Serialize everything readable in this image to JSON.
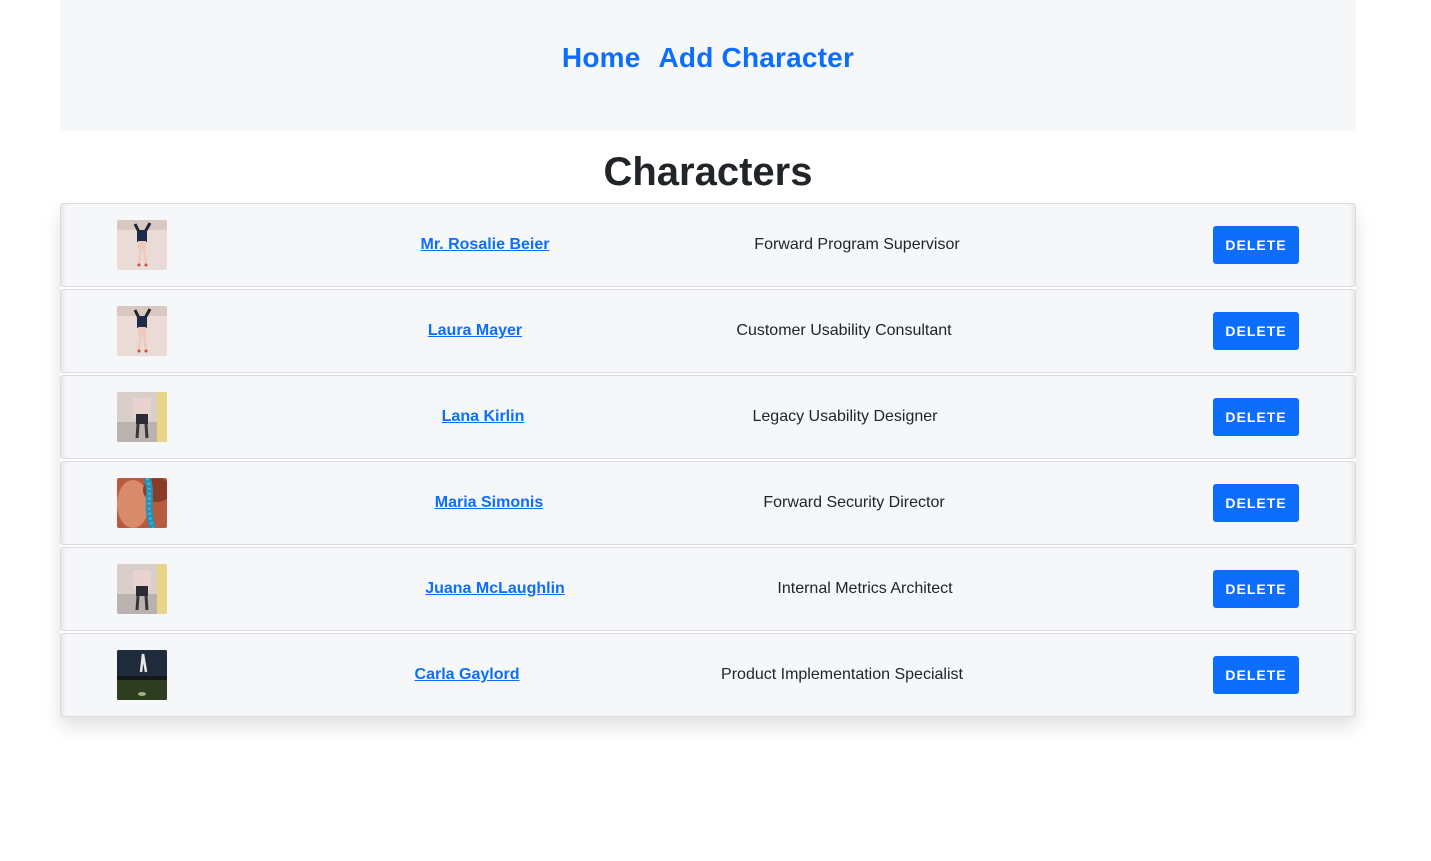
{
  "nav": {
    "home_label": "Home",
    "add_label": "Add Character"
  },
  "page": {
    "title": "Characters"
  },
  "characters": [
    {
      "name": "Mr. Rosalie Beier",
      "title": "Forward Program Supervisor",
      "delete_label": "DELETE",
      "avatar": "jumping-person-photo"
    },
    {
      "name": "Laura Mayer",
      "title": "Customer Usability Consultant",
      "delete_label": "DELETE",
      "avatar": "jumping-person-photo"
    },
    {
      "name": "Lana Kirlin",
      "title": "Legacy Usability Designer",
      "delete_label": "DELETE",
      "avatar": "street-fashion-photo"
    },
    {
      "name": "Maria Simonis",
      "title": "Forward Security Director",
      "delete_label": "DELETE",
      "avatar": "beaded-bracelet-photo"
    },
    {
      "name": "Juana McLaughlin",
      "title": "Internal Metrics Architect",
      "delete_label": "DELETE",
      "avatar": "street-fashion-photo"
    },
    {
      "name": "Carla Gaylord",
      "title": "Product Implementation Specialist",
      "delete_label": "DELETE",
      "avatar": "night-field-photo"
    }
  ],
  "colors": {
    "accent": "#0d6efd",
    "panel_bg": "#f6f7f9",
    "text": "#212529"
  }
}
